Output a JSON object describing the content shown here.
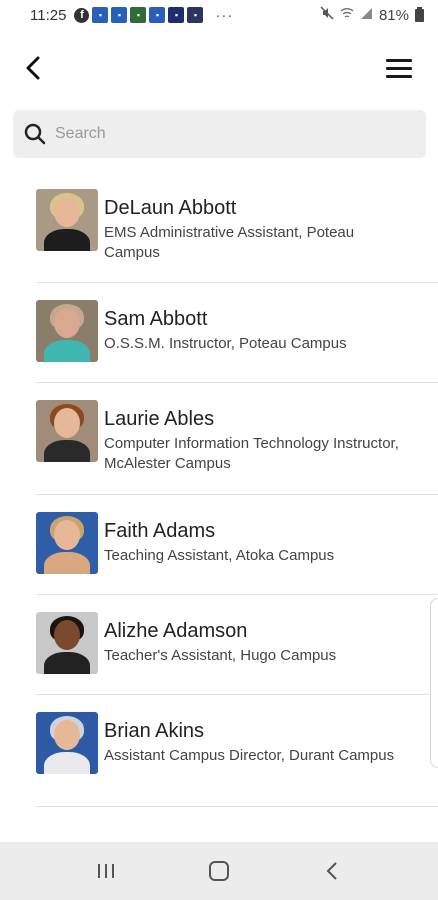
{
  "status_bar": {
    "time": "11:25",
    "notification_icons": [
      "facebook-icon",
      "app-icon",
      "app-icon",
      "app-icon",
      "app-icon",
      "app-icon",
      "app-icon"
    ],
    "more": "···",
    "battery_percent": "81%"
  },
  "header": {
    "back_icon": "chevron-left-icon",
    "menu_icon": "hamburger-menu-icon"
  },
  "search": {
    "placeholder": "Search",
    "value": ""
  },
  "people": [
    {
      "name": "DeLaun Abbott",
      "title": "EMS Administrative Assistant, Poteau Campus"
    },
    {
      "name": "Sam Abbott",
      "title": "O.S.S.M. Instructor, Poteau Campus"
    },
    {
      "name": "Laurie Ables",
      "title": "Computer Information Technology Instructor, McAlester Campus"
    },
    {
      "name": "Faith Adams",
      "title": "Teaching Assistant, Atoka Campus"
    },
    {
      "name": "Alizhe Adamson",
      "title": "Teacher's Assistant, Hugo Campus"
    },
    {
      "name": "Brian Akins",
      "title": "Assistant Campus Director, Durant Campus"
    }
  ],
  "navbar": {
    "recents_icon": "recent-apps-icon",
    "home_icon": "home-icon",
    "back_icon": "back-icon"
  },
  "colors": {
    "search_bg": "#eeeeee",
    "divider": "#e2e2e2",
    "navbar_bg": "#ececec"
  }
}
